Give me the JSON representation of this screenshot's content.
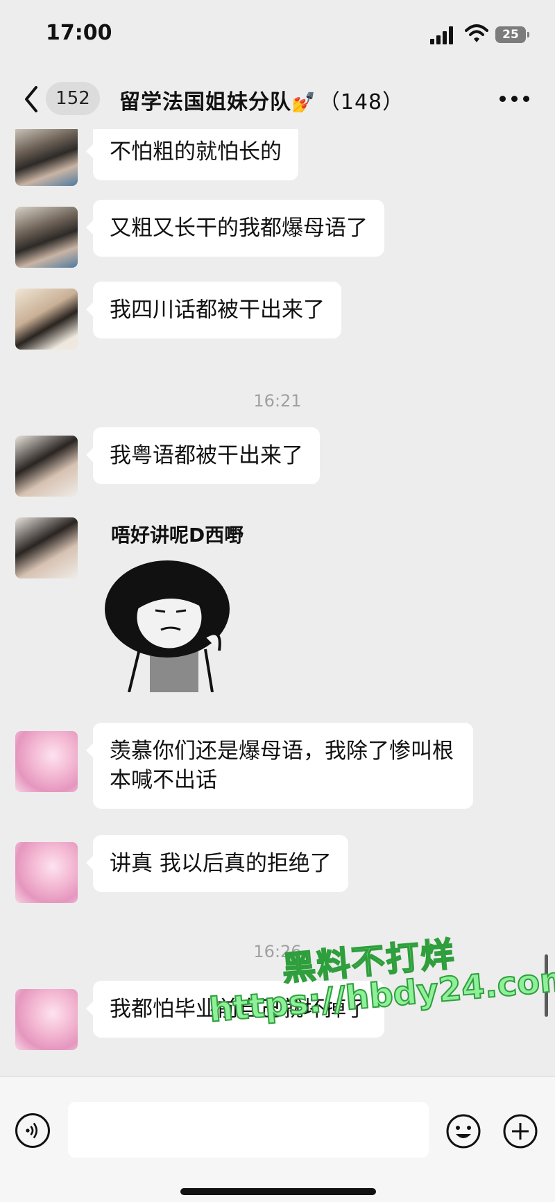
{
  "status_bar": {
    "time": "17:00",
    "battery": "25"
  },
  "header": {
    "unread_count": "152",
    "group_name": "留学法国姐妹分队",
    "emoji": "💅",
    "member_count": "（148）"
  },
  "messages": [
    {
      "type": "text",
      "avatar": "avatar-a",
      "text": "不怕粗的就怕长的"
    },
    {
      "type": "text",
      "avatar": "avatar-a",
      "text": "又粗又长干的我都爆母语了"
    },
    {
      "type": "text",
      "avatar": "avatar-b",
      "text": "我四川话都被干出来了"
    },
    {
      "type": "timestamp",
      "text": "16:21"
    },
    {
      "type": "text",
      "avatar": "avatar-c",
      "text": "我粤语都被干出来了"
    },
    {
      "type": "sticker",
      "avatar": "avatar-c",
      "caption": "唔好讲呢D西嘢"
    },
    {
      "type": "text",
      "avatar": "avatar-d",
      "text": "羡慕你们还是爆母语，我除了惨叫根本喊不出话"
    },
    {
      "type": "text",
      "avatar": "avatar-d",
      "text": "讲真 我以后真的拒绝了"
    },
    {
      "type": "timestamp",
      "text": "16:26"
    },
    {
      "type": "text",
      "avatar": "avatar-d",
      "text": "我都怕毕业前自己就坏掉了"
    }
  ],
  "watermark": {
    "line1": "黑料不打烊",
    "line2": "https://hbdy24.com"
  },
  "input": {
    "placeholder": ""
  },
  "colors": {
    "background": "#ededed",
    "bubble": "#ffffff",
    "watermark": "#8ff09a"
  }
}
